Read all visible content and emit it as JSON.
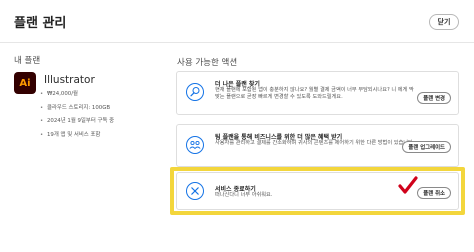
{
  "header": {
    "title": "플랜 관리",
    "close_label": "닫기"
  },
  "my_plan": {
    "heading": "내 플랜",
    "icon_text": "Ai",
    "app_name": "Illustrator",
    "details": [
      "₩24,000/월",
      "클라우드 스토리지: 100GB",
      "2024년 1월 9일부터 구독 중",
      "19개 앱 및 서비스 포함"
    ]
  },
  "actions": {
    "heading": "사용 가능한 액션",
    "cards": [
      {
        "icon": "search-icon",
        "title": "더 나은 플랜 찾기",
        "description": "현재 플랜에 포함된 앱이 충분하지 않나요? 월별 결제 금액이 너무 부담되시나요? 니 에게 딱 맞는 플랜으로 곧장 빠르게 변경할 수 있도록 도와드릴게요.",
        "button": "플랜 변경"
      },
      {
        "icon": "people-icon",
        "title": "팀 플랜을 통해 비즈니스를 위한 더 많은 혜택 받기",
        "description": "사용자를 관리하고 결제를 간소화하며 귀사의 콘텐츠를 제어하기 위한 다른 방법이 있습니다.",
        "button": "플랜 업그레이드"
      },
      {
        "icon": "cancel-icon",
        "title": "서비스 종료하기",
        "description": "떠나신다니 너무 아쉬워요.",
        "button": "플랜 취소"
      }
    ]
  },
  "colors": {
    "highlight": "#f3d63c",
    "checkmark": "#d0021b",
    "app_icon_bg": "#330000",
    "app_icon_fg": "#ff9a00",
    "card_icon": "#1473e6"
  }
}
